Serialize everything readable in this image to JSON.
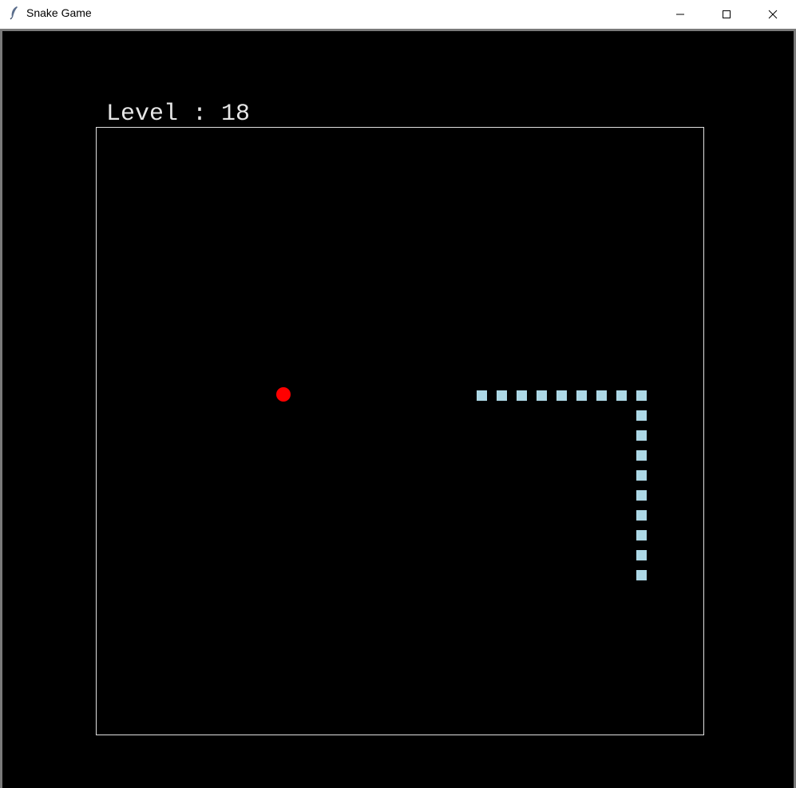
{
  "window": {
    "title": "Snake Game",
    "icon": "feather-icon"
  },
  "hud": {
    "level_text": "Level : 18",
    "level": 18
  },
  "game": {
    "food_color": "#ff0000",
    "snake_color": "#add8e6",
    "grid_cell": 25,
    "food": {
      "col": 9,
      "row": 13
    },
    "snake": [
      {
        "col": 19,
        "row": 13
      },
      {
        "col": 20,
        "row": 13
      },
      {
        "col": 21,
        "row": 13
      },
      {
        "col": 22,
        "row": 13
      },
      {
        "col": 23,
        "row": 13
      },
      {
        "col": 24,
        "row": 13
      },
      {
        "col": 25,
        "row": 13
      },
      {
        "col": 26,
        "row": 13
      },
      {
        "col": 27,
        "row": 13
      },
      {
        "col": 27,
        "row": 14
      },
      {
        "col": 27,
        "row": 15
      },
      {
        "col": 27,
        "row": 16
      },
      {
        "col": 27,
        "row": 17
      },
      {
        "col": 27,
        "row": 18
      },
      {
        "col": 27,
        "row": 19
      },
      {
        "col": 27,
        "row": 20
      },
      {
        "col": 27,
        "row": 21
      },
      {
        "col": 27,
        "row": 22
      }
    ]
  }
}
